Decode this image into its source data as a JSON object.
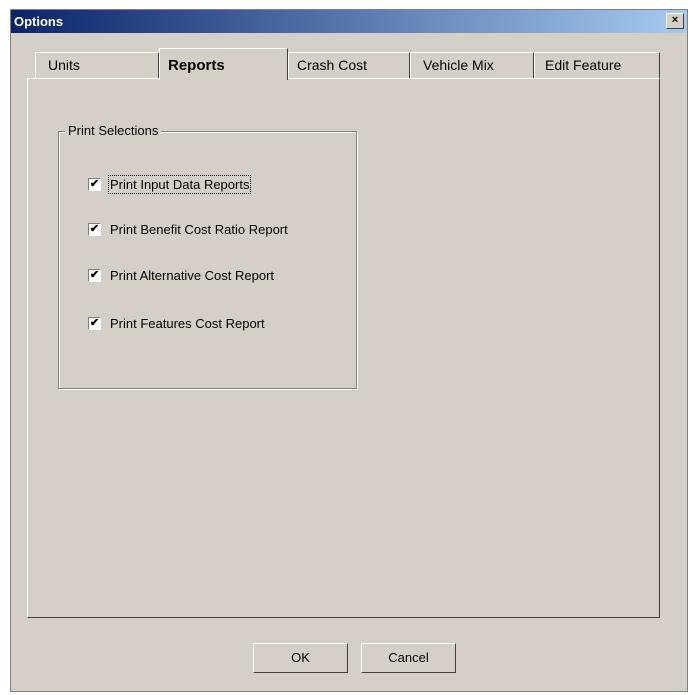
{
  "window": {
    "title": "Options",
    "close_label": "×"
  },
  "tabs": [
    {
      "label": "Units",
      "active": false
    },
    {
      "label": "Reports",
      "active": true
    },
    {
      "label": "Crash Cost",
      "active": false
    },
    {
      "label": "Vehicle Mix",
      "active": false
    },
    {
      "label": "Edit Feature",
      "active": false
    }
  ],
  "print_selections": {
    "label": "Print Selections",
    "items": [
      {
        "label": "Print Input Data Reports",
        "checked": true
      },
      {
        "label": "Print Benefit Cost Ratio Report",
        "checked": true
      },
      {
        "label": "Print Alternative Cost Report",
        "checked": true
      },
      {
        "label": "Print Features Cost Report",
        "checked": true
      }
    ]
  },
  "buttons": {
    "ok": "OK",
    "cancel": "Cancel"
  },
  "check_mark": "✔"
}
